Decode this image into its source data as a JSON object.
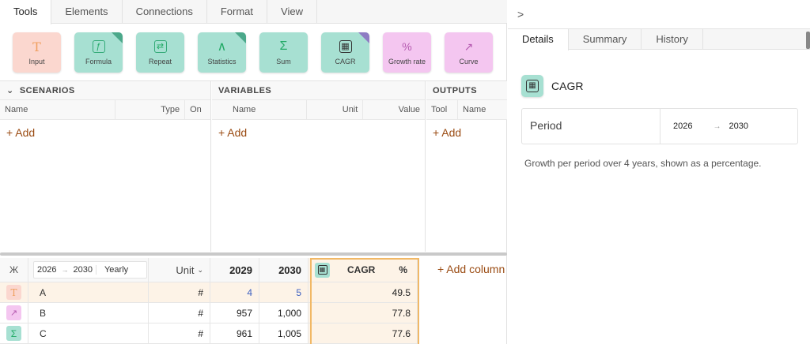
{
  "tabs": [
    "Tools",
    "Elements",
    "Connections",
    "Format",
    "View"
  ],
  "tools": [
    {
      "label": "Input",
      "icon": "T",
      "color": "orange",
      "corner": ""
    },
    {
      "label": "Formula",
      "icon": "ƒ",
      "color": "teal",
      "corner": "green"
    },
    {
      "label": "Repeat",
      "icon": "⇄",
      "color": "teal",
      "corner": ""
    },
    {
      "label": "Statistics",
      "icon": "∧",
      "color": "teal",
      "corner": "green"
    },
    {
      "label": "Sum",
      "icon": "Σ",
      "color": "teal",
      "corner": ""
    },
    {
      "label": "CAGR",
      "icon": "▦",
      "color": "teal",
      "corner": "purple"
    },
    {
      "label": "Growth rate",
      "icon": "%",
      "color": "pink",
      "corner": ""
    },
    {
      "label": "Curve",
      "icon": "↗",
      "color": "pink",
      "corner": ""
    }
  ],
  "panels": {
    "scenarios": {
      "title": "SCENARIOS",
      "collapse_glyph": "⌄",
      "cols": [
        "Name",
        "Type",
        "On"
      ],
      "add": "+ Add"
    },
    "variables": {
      "title": "VARIABLES",
      "cols": [
        "Name",
        "Unit",
        "Value"
      ],
      "add": "+ Add"
    },
    "outputs": {
      "title": "OUTPUTS",
      "cols": [
        "Tool",
        "Name"
      ],
      "add": "+ Add"
    }
  },
  "grid": {
    "pin_glyph": "Ж",
    "period_start": "2026",
    "period_end": "2030",
    "arrow": "→",
    "frequency": "Yearly",
    "unit_header": "Unit",
    "year_headers": [
      "2029",
      "2030"
    ],
    "cagr_header": "CAGR",
    "cagr_unit": "%",
    "add_column": "+  Add column",
    "rows": [
      {
        "icon": "T",
        "icon_color": "#fbd7cf",
        "name": "A",
        "unit": "#",
        "v2029": "4",
        "v2030": "5",
        "cagr": "49.5"
      },
      {
        "icon": "↗",
        "icon_color": "#f4c6f0",
        "name": "B",
        "unit": "#",
        "v2029": "957",
        "v2030": "1,000",
        "cagr": "77.8"
      },
      {
        "icon": "Σ",
        "icon_color": "#a7e0d2",
        "name": "C",
        "unit": "#",
        "v2029": "961",
        "v2030": "1,005",
        "cagr": "77.6"
      }
    ]
  },
  "right": {
    "chevron": ">",
    "tabs": [
      "Details",
      "Summary",
      "History"
    ],
    "tool_icon": "▦",
    "title": "CAGR",
    "period_label": "Period",
    "period_start": "2026",
    "period_arrow": "→",
    "period_end": "2030",
    "description": "Growth per period over 4 years, shown as a percentage."
  }
}
